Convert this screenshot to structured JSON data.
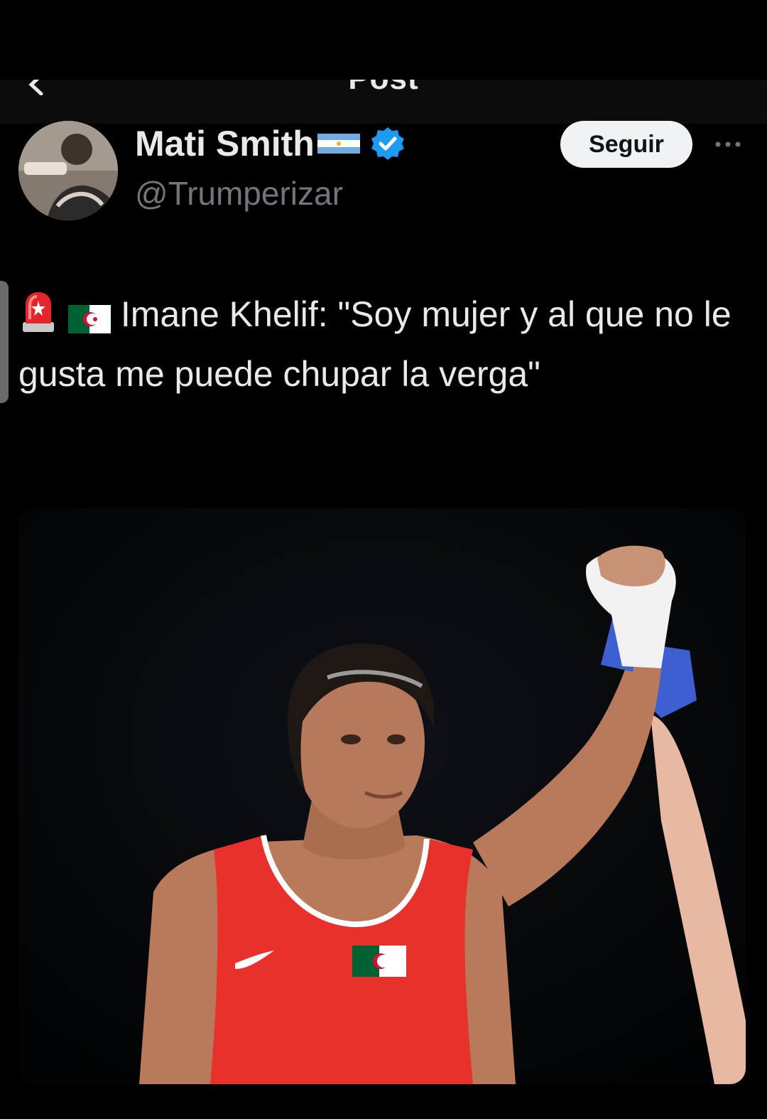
{
  "header": {
    "title": "Post",
    "back_icon": "chevron-left-icon"
  },
  "author": {
    "display_name": "Mati Smith",
    "handle": "@Trumperizar",
    "flag_icon": "argentina-flag-icon",
    "verified_icon": "verified-badge-icon",
    "verified_color": "#1d9bf0"
  },
  "actions": {
    "follow_label": "Seguir",
    "more_icon": "more-options-icon"
  },
  "tweet": {
    "prefix_icons": [
      "siren-emoji-icon",
      "algeria-flag-emoji-icon"
    ],
    "text": "Imane Khelif: \"Soy mujer y al que no le gusta me puede chupar la verga\""
  },
  "media": {
    "kit_color": "#e8312b",
    "glove_color": "#3e5fd1"
  }
}
